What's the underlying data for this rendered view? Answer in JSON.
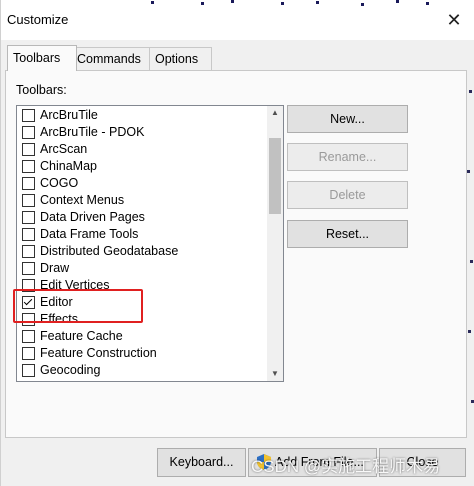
{
  "window": {
    "title": "Customize",
    "close_glyph": "✕"
  },
  "tabs": [
    {
      "label": "Toolbars",
      "active": true
    },
    {
      "label": "Commands",
      "active": false
    },
    {
      "label": "Options",
      "active": false
    }
  ],
  "toolbars": {
    "label": "Toolbars:",
    "items": [
      {
        "label": "ArcBruTile",
        "checked": false
      },
      {
        "label": "ArcBruTile - PDOK",
        "checked": false
      },
      {
        "label": "ArcScan",
        "checked": false
      },
      {
        "label": "ChinaMap",
        "checked": false
      },
      {
        "label": "COGO",
        "checked": false
      },
      {
        "label": "Context Menus",
        "checked": false
      },
      {
        "label": "Data Driven Pages",
        "checked": false
      },
      {
        "label": "Data Frame Tools",
        "checked": false
      },
      {
        "label": "Distributed Geodatabase",
        "checked": false
      },
      {
        "label": "Draw",
        "checked": false
      },
      {
        "label": "Edit Vertices",
        "checked": false
      },
      {
        "label": "Editor",
        "checked": true
      },
      {
        "label": "Effects",
        "checked": false
      },
      {
        "label": "Feature Cache",
        "checked": false
      },
      {
        "label": "Feature Construction",
        "checked": false
      },
      {
        "label": "Geocoding",
        "checked": false
      }
    ]
  },
  "buttons": {
    "new": "New...",
    "rename": "Rename...",
    "delete": "Delete",
    "reset": "Reset..."
  },
  "bottom_buttons": {
    "keyboard": "Keyboard...",
    "add_from_file": "Add From File...",
    "close": "Close"
  },
  "watermark": "CSDN @实施工程师木易",
  "colors": {
    "highlight": "#e02020",
    "button_bg": "#e1e1e1"
  }
}
